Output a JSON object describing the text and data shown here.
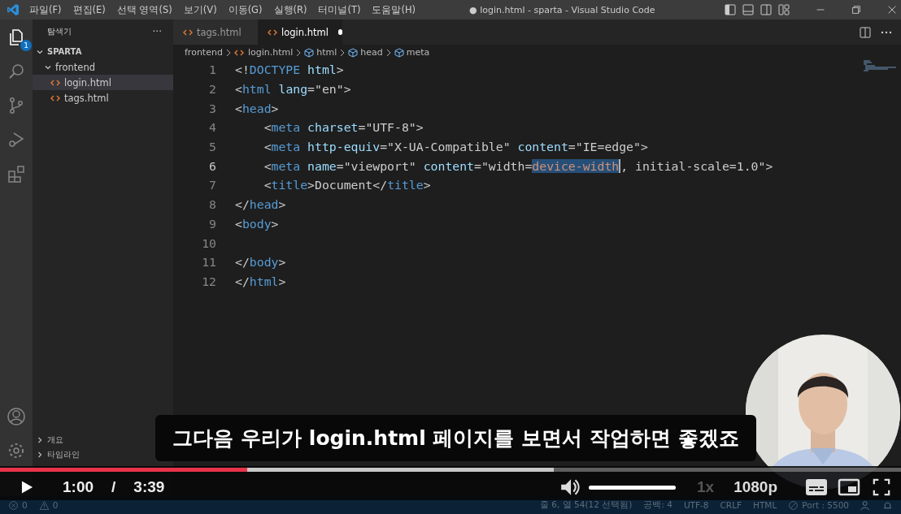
{
  "window": {
    "title": "● login.html - sparta - Visual Studio Code"
  },
  "menu": [
    "파일(F)",
    "편집(E)",
    "선택 영역(S)",
    "보기(V)",
    "이동(G)",
    "실행(R)",
    "터미널(T)",
    "도움말(H)"
  ],
  "activity_bar": {
    "badge": "1"
  },
  "explorer": {
    "title": "탐색기",
    "more": "···",
    "tree": [
      {
        "label": "SPARTA",
        "expanded": true,
        "selected": false,
        "children": [
          {
            "label": "frontend",
            "expanded": true,
            "selected": false,
            "children": [
              {
                "label": "login.html",
                "selected": true
              },
              {
                "label": "tags.html",
                "selected": false
              }
            ]
          }
        ]
      }
    ],
    "sections": [
      {
        "label": "개요",
        "expanded": false
      },
      {
        "label": "타임라인",
        "expanded": false
      }
    ]
  },
  "tabs": [
    {
      "label": "tags.html",
      "selected": false,
      "modified": false
    },
    {
      "label": "login.html",
      "selected": true,
      "modified": true
    }
  ],
  "breadcrumb": [
    {
      "label": "frontend",
      "kind": "folder"
    },
    {
      "label": "login.html",
      "kind": "file"
    },
    {
      "label": "html",
      "kind": "element"
    },
    {
      "label": "head",
      "kind": "element"
    },
    {
      "label": "meta",
      "kind": "element"
    }
  ],
  "code": [
    {
      "number": "1",
      "tokens": [
        {
          "kind": "punct",
          "text": "<!"
        },
        {
          "kind": "tag",
          "text": "DOCTYPE"
        },
        {
          "kind": "attr",
          "text": " html"
        },
        {
          "kind": "punct",
          "text": ">"
        }
      ]
    },
    {
      "number": "2",
      "tokens": [
        {
          "kind": "punct",
          "text": "<"
        },
        {
          "kind": "tag",
          "text": "html"
        },
        {
          "kind": "attr",
          "text": " lang"
        },
        {
          "kind": "plain",
          "text": "="
        },
        {
          "kind": "string",
          "text": "\"en\""
        },
        {
          "kind": "punct",
          "text": ">"
        }
      ]
    },
    {
      "number": "3",
      "tokens": [
        {
          "kind": "punct",
          "text": "<"
        },
        {
          "kind": "tag",
          "text": "head"
        },
        {
          "kind": "punct",
          "text": ">"
        }
      ]
    },
    {
      "number": "4",
      "tokens": [
        {
          "kind": "punct",
          "text": "    <"
        },
        {
          "kind": "tag",
          "text": "meta"
        },
        {
          "kind": "attr",
          "text": " charset"
        },
        {
          "kind": "plain",
          "text": "="
        },
        {
          "kind": "string",
          "text": "\"UTF-8\""
        },
        {
          "kind": "punct",
          "text": ">"
        }
      ]
    },
    {
      "number": "5",
      "tokens": [
        {
          "kind": "punct",
          "text": "    <"
        },
        {
          "kind": "tag",
          "text": "meta"
        },
        {
          "kind": "attr",
          "text": " http-equiv"
        },
        {
          "kind": "plain",
          "text": "="
        },
        {
          "kind": "string",
          "text": "\"X-UA-Compatible\""
        },
        {
          "kind": "attr",
          "text": " content"
        },
        {
          "kind": "plain",
          "text": "="
        },
        {
          "kind": "string",
          "text": "\"IE=edge\""
        },
        {
          "kind": "punct",
          "text": ">"
        }
      ]
    },
    {
      "number": "6",
      "tokens": [
        {
          "kind": "punct",
          "text": "    <"
        },
        {
          "kind": "tag",
          "text": "meta"
        },
        {
          "kind": "attr",
          "text": " name"
        },
        {
          "kind": "plain",
          "text": "="
        },
        {
          "kind": "string",
          "text": "\"viewport\""
        },
        {
          "kind": "attr",
          "text": " content"
        },
        {
          "kind": "plain",
          "text": "="
        },
        {
          "kind": "string",
          "text": "\"width="
        },
        {
          "kind": "selection",
          "text": "device-width"
        },
        {
          "kind": "string",
          "text": ", initial-scale=1.0\""
        },
        {
          "kind": "punct",
          "text": ">"
        }
      ]
    },
    {
      "number": "7",
      "tokens": [
        {
          "kind": "punct",
          "text": "    <"
        },
        {
          "kind": "tag",
          "text": "title"
        },
        {
          "kind": "punct",
          "text": ">"
        },
        {
          "kind": "plain",
          "text": "Document"
        },
        {
          "kind": "punct",
          "text": "</"
        },
        {
          "kind": "tag",
          "text": "title"
        },
        {
          "kind": "punct",
          "text": ">"
        }
      ]
    },
    {
      "number": "8",
      "tokens": [
        {
          "kind": "punct",
          "text": "</"
        },
        {
          "kind": "tag",
          "text": "head"
        },
        {
          "kind": "punct",
          "text": ">"
        }
      ]
    },
    {
      "number": "9",
      "tokens": [
        {
          "kind": "punct",
          "text": "<"
        },
        {
          "kind": "tag",
          "text": "body"
        },
        {
          "kind": "punct",
          "text": ">"
        }
      ]
    },
    {
      "number": "10"
    },
    {
      "number": "11",
      "tokens": [
        {
          "kind": "punct",
          "text": "</"
        },
        {
          "kind": "tag",
          "text": "body"
        },
        {
          "kind": "punct",
          "text": ">"
        }
      ]
    },
    {
      "number": "12",
      "tokens": [
        {
          "kind": "punct",
          "text": "</"
        },
        {
          "kind": "tag",
          "text": "html"
        },
        {
          "kind": "punct",
          "text": ">"
        }
      ]
    }
  ],
  "status_bar": {
    "errors": "0",
    "warnings": "0",
    "items": [
      "줄 6, 열 54(12 선택됨)",
      "공백: 4",
      "UTF-8",
      "CRLF",
      "HTML"
    ],
    "port": "Port : 5500"
  },
  "caption": "그다음 우리가 login.html 페이지를 보면서 작업하면 좋겠죠",
  "player": {
    "progress": {
      "level": 0.274
    },
    "buffer": {
      "level": 0.615
    },
    "current_time": "1:00",
    "separator": "/",
    "duration": "3:39",
    "volume": {
      "level": 1
    },
    "speed": "1x",
    "quality": "1080p"
  },
  "webcam": {
    "kind": "picture"
  }
}
